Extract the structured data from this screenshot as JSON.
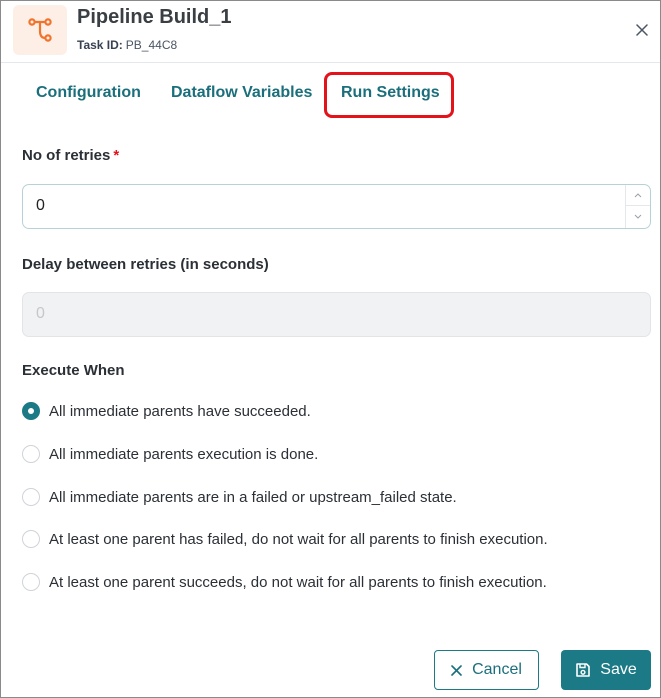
{
  "header": {
    "title": "Pipeline Build_1",
    "task_id_label": "Task ID:",
    "task_id_value": "PB_44C8",
    "icon": "pipeline-branch-icon",
    "close_icon": "close-icon"
  },
  "tabs": [
    {
      "label": "Configuration"
    },
    {
      "label": "Dataflow Variables"
    },
    {
      "label": "Run Settings",
      "active": true
    }
  ],
  "retries": {
    "label": "No of retries",
    "required_mark": "*",
    "value": "0"
  },
  "delay": {
    "label": "Delay between retries (in seconds)",
    "value": "0",
    "disabled": true
  },
  "execute_when": {
    "label": "Execute When",
    "options": [
      {
        "label": "All immediate parents have succeeded.",
        "selected": true
      },
      {
        "label": "All immediate parents execution is done.",
        "selected": false
      },
      {
        "label": "All immediate parents are in a failed or upstream_failed state.",
        "selected": false
      },
      {
        "label": "At least one parent has failed, do not wait for all parents to finish execution.",
        "selected": false
      },
      {
        "label": "At least one parent succeeds, do not wait for all parents to finish execution.",
        "selected": false
      }
    ]
  },
  "footer": {
    "cancel_label": "Cancel",
    "save_label": "Save"
  },
  "colors": {
    "accent": "#1b7a86",
    "highlight": "#e3121b",
    "icon_accent": "#f0742c"
  }
}
